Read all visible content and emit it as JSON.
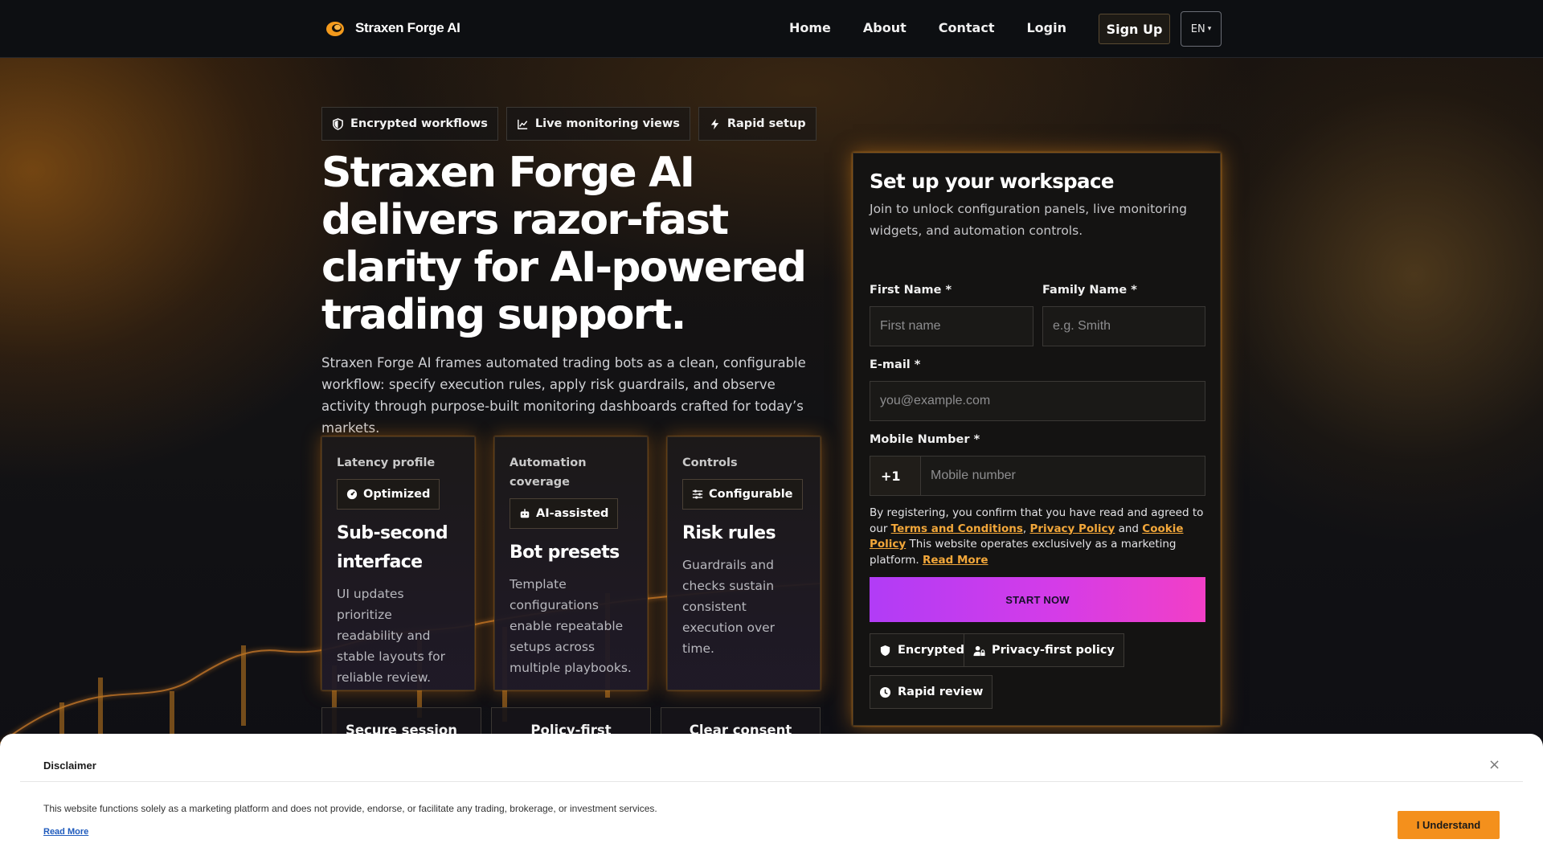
{
  "colors": {
    "accent": "#f4901c",
    "link_accent": "#f2a73a",
    "cta_gradient_start": "#b13cf6",
    "cta_gradient_end": "#f23fc6",
    "page_bg": "#0c0d10"
  },
  "nav": {
    "brand": "Straxen Forge AI",
    "logo_icon": "orange-disc-logo-icon",
    "links": [
      "Home",
      "About",
      "Contact",
      "Login"
    ],
    "signup": "Sign Up",
    "language": "EN",
    "language_caret": "▾"
  },
  "hero": {
    "pills": [
      {
        "label": "Encrypted workflows",
        "icon": "shield-icon"
      },
      {
        "label": "Live monitoring views",
        "icon": "line-chart-icon"
      },
      {
        "label": "Rapid setup",
        "icon": "lightning-icon"
      }
    ],
    "title": "Straxen Forge AI delivers razor-fast clarity for AI-powered trading support.",
    "description": "Straxen Forge AI frames automated trading bots as a clean, configurable workflow: specify execution rules, apply risk guardrails, and observe activity through purpose-built monitoring dashboards crafted for today’s markets."
  },
  "cards": [
    {
      "label": "Latency profile",
      "badge": "Optimized",
      "badge_icon": "gauge-icon",
      "title": "Sub-second interface",
      "text": "UI updates prioritize readability and stable layouts for reliable review."
    },
    {
      "label": "Automation coverage",
      "badge": "AI-assisted",
      "badge_icon": "robot-icon",
      "title": "Bot presets",
      "text": "Template configurations enable repeatable setups across multiple playbooks."
    },
    {
      "label": "Controls",
      "badge": "Configurable",
      "badge_icon": "sliders-icon",
      "title": "Risk rules",
      "text": "Guardrails and checks sustain consistent execution over time."
    }
  ],
  "mini_cards": [
    "Secure session",
    "Policy-first",
    "Clear consent"
  ],
  "form": {
    "title": "Set up your workspace",
    "subtitle": "Join to unlock configuration panels, live monitoring widgets, and automation controls.",
    "first_name_label": "First Name *",
    "first_name_placeholder": "First name",
    "family_name_label": "Family Name *",
    "family_name_placeholder": "e.g. Smith",
    "email_label": "E-mail *",
    "email_placeholder": "you@example.com",
    "mobile_label": "Mobile Number *",
    "mobile_prefix": "+1",
    "mobile_placeholder": "Mobile number",
    "consent_text_1": "By registering, you confirm that you have read and agreed to our ",
    "terms_link": "Terms and Conditions",
    "consent_sep": ", ",
    "privacy_link": "Privacy Policy",
    "consent_and": " and ",
    "cookie_link": "Cookie Policy",
    "consent_text_2": " This website operates exclusively as a marketing platform. ",
    "read_more_link": "Read More",
    "submit": "START NOW",
    "trust_badges": [
      {
        "label": "Encrypted",
        "icon": "shield-icon"
      },
      {
        "label": "Privacy-first policy",
        "icon": "user-lock-icon"
      },
      {
        "label": "Rapid review",
        "icon": "clock-icon"
      }
    ]
  },
  "disclaimer": {
    "title": "Disclaimer",
    "close": "×",
    "text": "This website functions solely as a marketing platform and does not provide, endorse, or facilitate any trading, brokerage, or investment services.",
    "read_more": "Read More",
    "button": "I Understand"
  }
}
